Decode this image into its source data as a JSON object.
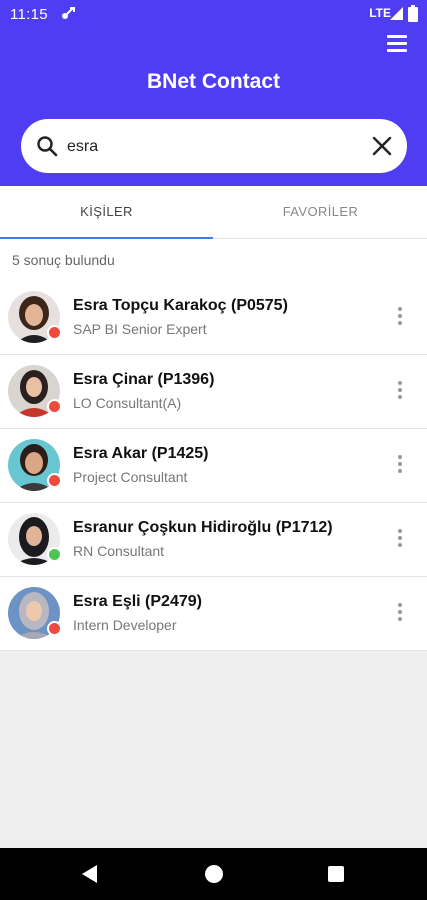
{
  "status_bar": {
    "time": "11:15",
    "network": "LTE"
  },
  "header": {
    "title": "BNet Contact",
    "menu_icon": "hamburger-menu-icon"
  },
  "search": {
    "value": "esra",
    "search_icon": "search-icon",
    "clear_icon": "close-icon"
  },
  "tabs": [
    {
      "label": "KİŞİLER",
      "active": true
    },
    {
      "label": "FAVORİLER",
      "active": false
    }
  ],
  "results": {
    "count_text": "5 sonuç bulundu"
  },
  "contacts": [
    {
      "name": "Esra Topçu Karakoç (P0575)",
      "role": "SAP BI Senior Expert",
      "status": "offline",
      "status_color": "#f04a3e"
    },
    {
      "name": "Esra Çinar (P1396)",
      "role": "LO Consultant(A)",
      "status": "offline",
      "status_color": "#f04a3e"
    },
    {
      "name": "Esra Akar (P1425)",
      "role": "Project Consultant",
      "status": "offline",
      "status_color": "#f04a3e"
    },
    {
      "name": "Esranur Çoşkun Hidiroğlu (P1712)",
      "role": "RN Consultant",
      "status": "online",
      "status_color": "#4cc552"
    },
    {
      "name": "Esra Eşli (P2479)",
      "role": "Intern Developer",
      "status": "offline",
      "status_color": "#f04a3e"
    }
  ],
  "colors": {
    "header_bg": "#4f3df3",
    "tab_indicator": "#3d7ee6",
    "offline": "#f04a3e",
    "online": "#4cc552"
  },
  "nav_bar": {
    "back_icon": "back-triangle-icon",
    "home_icon": "home-circle-icon",
    "recents_icon": "recents-square-icon"
  }
}
